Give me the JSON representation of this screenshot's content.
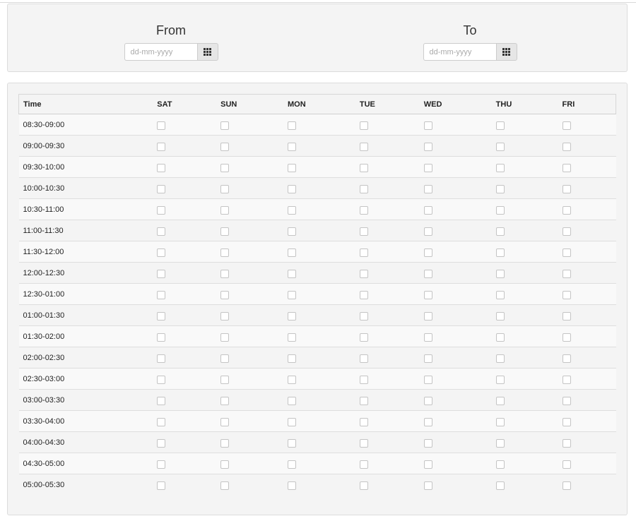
{
  "date_range": {
    "from": {
      "label": "From",
      "placeholder": "dd-mm-yyyy",
      "value": ""
    },
    "to": {
      "label": "To",
      "placeholder": "dd-mm-yyyy",
      "value": ""
    },
    "calendar_icon": "calendar-grid-icon"
  },
  "schedule": {
    "columns": [
      "Time",
      "SAT",
      "SUN",
      "MON",
      "TUE",
      "WED",
      "THU",
      "FRI"
    ],
    "slots": [
      "08:30-09:00",
      "09:00-09:30",
      "09:30-10:00",
      "10:00-10:30",
      "10:30-11:00",
      "11:00-11:30",
      "11:30-12:00",
      "12:00-12:30",
      "12:30-01:00",
      "01:00-01:30",
      "01:30-02:00",
      "02:00-02:30",
      "02:30-03:00",
      "03:00-03:30",
      "03:30-04:00",
      "04:00-04:30",
      "04:30-05:00",
      "05:00-05:30"
    ],
    "checked": false
  }
}
